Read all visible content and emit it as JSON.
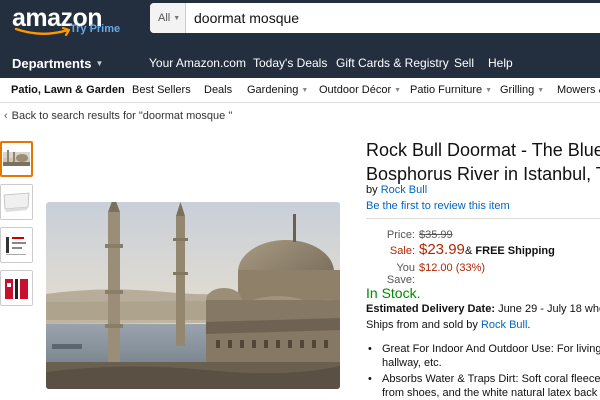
{
  "header": {
    "logo_text": "amazon",
    "logo_sub": "Try Prime",
    "search": {
      "category": "All",
      "query": "doormat mosque"
    }
  },
  "nav": {
    "departments": "Departments",
    "links": [
      "Your Amazon.com",
      "Today's Deals",
      "Gift Cards & Registry",
      "Sell",
      "Help"
    ]
  },
  "subnav": {
    "category": "Patio, Lawn & Garden",
    "items": [
      "Best Sellers",
      "Deals",
      "Gardening",
      "Outdoor Décor",
      "Patio Furniture",
      "Grilling",
      "Mowers &"
    ]
  },
  "breadcrumb": "Back to search results for \"doormat mosque \"",
  "product": {
    "title_line1": "Rock Bull Doormat - The Blue",
    "title_line2": "Bosphorus River in Istanbul, Tu",
    "by": "by",
    "brand": "Rock Bull",
    "review_link": "Be the first to review this item",
    "price_label": "Price:",
    "list_price": "$35.99",
    "sale_label": "Sale:",
    "sale_price": "$23.99",
    "shipping_amp": "&",
    "shipping": "FREE Shipping",
    "save_label": "You Save:",
    "savings": "$12.00 (33%)",
    "stock": "In Stock.",
    "delivery_label": "Estimated Delivery Date:",
    "delivery_dates": "June 29 - July 18 whe",
    "ships_from": "Ships from and sold by",
    "seller": "Rock Bull",
    "seller_end": ".",
    "bullets": [
      [
        "Great For Indoor And Outdoor Use: For living",
        "hallway, etc."
      ],
      [
        "Absorbs Water & Traps Dirt: Soft coral fleece s",
        "from shoes, and the white natural latex back p"
      ]
    ]
  },
  "colors": {
    "header_bg": "#232f3e",
    "link": "#0066c0",
    "price_red": "#b12704",
    "stock_green": "#008a00",
    "thumb_selected": "#e77600"
  }
}
